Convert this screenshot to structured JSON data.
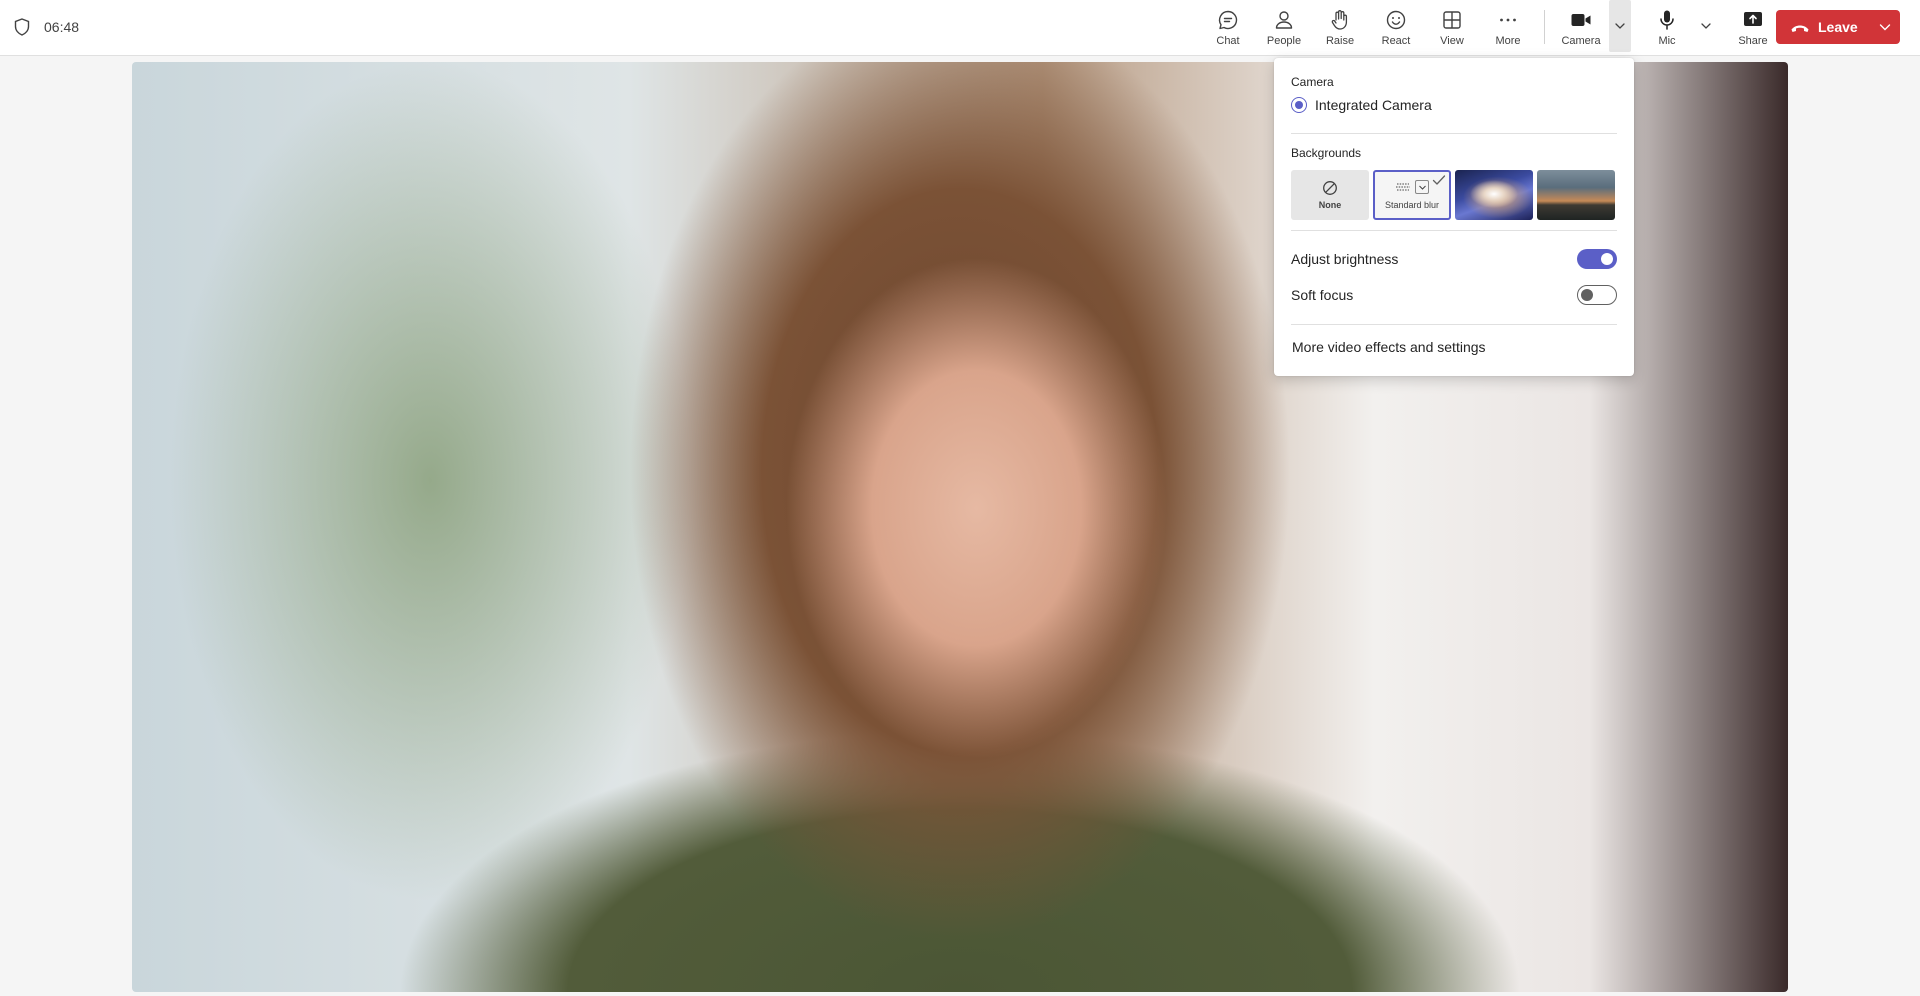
{
  "meeting": {
    "timer": "06:48"
  },
  "toolbar": {
    "chat_label": "Chat",
    "people_label": "People",
    "raise_label": "Raise",
    "react_label": "React",
    "view_label": "View",
    "more_label": "More",
    "camera_label": "Camera",
    "mic_label": "Mic",
    "share_label": "Share",
    "leave_label": "Leave"
  },
  "video": {
    "description_label": "Local camera preview"
  },
  "camera_menu": {
    "camera_section_title": "Camera",
    "selected_camera": "Integrated Camera",
    "backgrounds_section_title": "Backgrounds",
    "backgrounds": [
      {
        "label": "None",
        "selected": false
      },
      {
        "label": "Standard blur",
        "selected": true
      },
      {
        "label": "",
        "selected": false
      },
      {
        "label": "",
        "selected": false
      }
    ],
    "adjust_brightness_label": "Adjust brightness",
    "adjust_brightness_on": true,
    "soft_focus_label": "Soft focus",
    "soft_focus_on": false,
    "more_settings_label": "More video effects and settings"
  },
  "colors": {
    "accent": "#5b5fc7",
    "leave_red": "#d13438"
  }
}
